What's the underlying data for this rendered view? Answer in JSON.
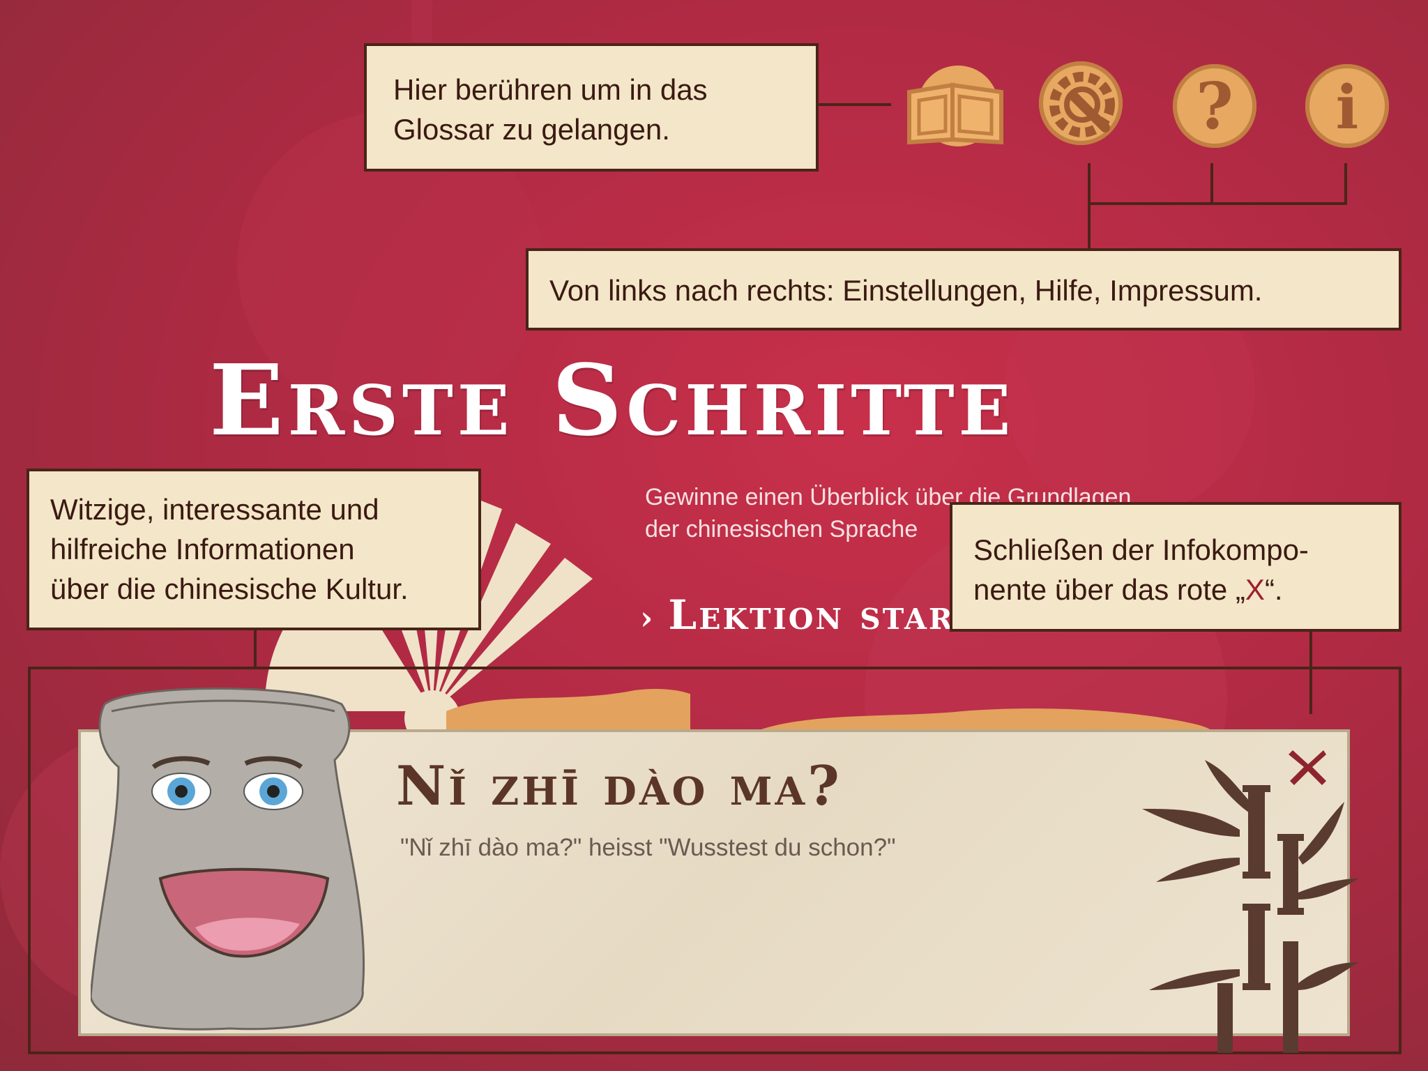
{
  "page": {
    "title": "Erste Schritte",
    "subtitle_line1": "Gewinne einen Überblick über die Grundlagen",
    "subtitle_line2": "der chinesischen Sprache",
    "start_lesson": "Lektion starten"
  },
  "toolbar": {
    "icons": [
      "glossary-book-icon",
      "settings-gear-icon",
      "help-question-icon",
      "imprint-info-icon"
    ]
  },
  "callouts": {
    "glossary": "Hier berühren um in das Glossar zu gelangen.",
    "glossary_line1": "Hier berühren um in das",
    "glossary_line2": "Glossar zu gelangen.",
    "toolbar": "Von links nach rechts: Einstellungen, Hilfe, Impressum.",
    "culture_line1": "Witzige, interessante und",
    "culture_line2": "hilfreiche Informationen",
    "culture_line3": "über die chinesische Kultur.",
    "close_line1": "Schließen der Infokompo-",
    "close_line2_prefix": "nente über das rote „",
    "close_line2_x": "X",
    "close_line2_suffix": "“."
  },
  "info_panel": {
    "heading": "Nǐ zhī dào ma?",
    "text": "\"Nǐ zhī dào ma?\" heisst \"Wusstest du schon?\"",
    "close_label": "X"
  },
  "colors": {
    "background": "#b12a44",
    "callout_bg": "#f4e6c8",
    "callout_border": "#4a2418",
    "icon_fill": "#e7a862",
    "close_x": "#8e2430"
  }
}
